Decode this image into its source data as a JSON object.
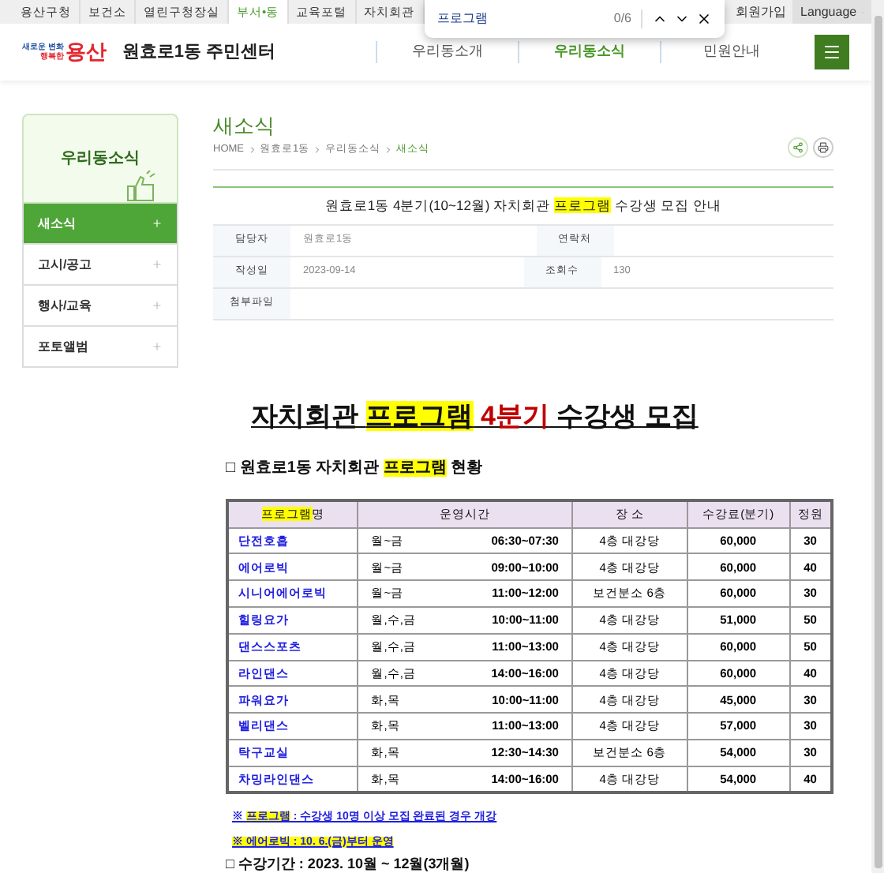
{
  "top_links": [
    {
      "label": "용산구청",
      "selected": false
    },
    {
      "label": "보건소",
      "selected": false
    },
    {
      "label": "열린구청장실",
      "selected": false
    },
    {
      "label": "부서•동",
      "selected": true
    },
    {
      "label": "교육포털",
      "selected": false
    },
    {
      "label": "자치회관",
      "selected": false
    }
  ],
  "signup": "회원가입",
  "language": "Language",
  "find_bar": {
    "query": "프로그램",
    "count": "0/6"
  },
  "logo": {
    "slogan_1": "새로운 변화",
    "slogan_2": "행복한",
    "name": "용산"
  },
  "site_title": "원효로1동 주민센터",
  "main_nav": [
    {
      "label": "우리동소개",
      "selected": false
    },
    {
      "label": "우리동소식",
      "selected": true
    },
    {
      "label": "민원안내",
      "selected": false
    }
  ],
  "sidebar": {
    "title": "우리동소식",
    "items": [
      {
        "label": "새소식",
        "selected": true
      },
      {
        "label": "고시/공고",
        "selected": false
      },
      {
        "label": "행사/교육",
        "selected": false
      },
      {
        "label": "포토앨범",
        "selected": false
      }
    ]
  },
  "page_title": "새소식",
  "breadcrumb": [
    "HOME",
    "원효로1동",
    "우리동소식",
    "새소식"
  ],
  "post": {
    "title": [
      {
        "text": "원효로1동 4분기(10~12월) 자치회관 ",
        "highlight": false
      },
      {
        "text": "프로그램",
        "highlight": true
      },
      {
        "text": " 수강생 모집 안내",
        "highlight": false
      }
    ],
    "info": [
      [
        {
          "label": "담당자",
          "value": "원효로1동"
        },
        {
          "label": "연락처"
        }
      ],
      [
        {
          "label": "작성일",
          "value": "2023-09-14"
        },
        {
          "label": "조회수",
          "value": "130"
        }
      ],
      [
        {
          "label": "첨부파일"
        }
      ]
    ]
  },
  "heading": [
    {
      "text": "자치회관 ",
      "highlight": false,
      "red": false
    },
    {
      "text": "프로그램",
      "highlight": true,
      "red": false
    },
    {
      "text": " 4분기",
      "highlight": false,
      "red": true
    },
    {
      "text": " 수강생 모집",
      "highlight": false,
      "red": false
    }
  ],
  "subheading": [
    {
      "text": "□ 원효로1동 자치회관 ",
      "highlight": false
    },
    {
      "text": "프로그램",
      "highlight": true
    },
    {
      "text": " 현황",
      "highlight": false
    }
  ],
  "table": {
    "columns": [
      [
        {
          "text": "프로그램",
          "highlight": true
        },
        {
          "text": "명",
          "highlight": false
        }
      ],
      [
        {
          "text": "운영시간",
          "highlight": false
        }
      ],
      [
        {
          "text": "장 소",
          "highlight": false
        }
      ],
      [
        {
          "text": "수강료(분기)",
          "highlight": false
        }
      ],
      [
        {
          "text": "정원",
          "highlight": false
        }
      ]
    ],
    "rows": [
      {
        "name": "단전호흡",
        "days": "월~금",
        "time": "06:30~07:30",
        "place": "4층 대강당",
        "fee": "60,000",
        "capacity": "30"
      },
      {
        "name": "에어로빅",
        "days": "월~금",
        "time": "09:00~10:00",
        "place": "4층 대강당",
        "fee": "60,000",
        "capacity": "40"
      },
      {
        "name": "시니어에어로빅",
        "days": "월~금",
        "time": "11:00~12:00",
        "place": "보건분소 6층",
        "fee": "60,000",
        "capacity": "30"
      },
      {
        "name": "힐링요가",
        "days": "월,수,금",
        "time": "10:00~11:00",
        "place": "4층 대강당",
        "fee": "51,000",
        "capacity": "50"
      },
      {
        "name": "댄스스포츠",
        "days": "월,수,금",
        "time": "11:00~13:00",
        "place": "4층 대강당",
        "fee": "60,000",
        "capacity": "50"
      },
      {
        "name": "라인댄스",
        "days": "월,수,금",
        "time": "14:00~16:00",
        "place": "4층 대강당",
        "fee": "60,000",
        "capacity": "40"
      },
      {
        "name": "파워요가",
        "days": "화,목",
        "time": "10:00~11:00",
        "place": "4층 대강당",
        "fee": "45,000",
        "capacity": "30"
      },
      {
        "name": "벨리댄스",
        "days": "화,목",
        "time": "11:00~13:00",
        "place": "4층 대강당",
        "fee": "57,000",
        "capacity": "30"
      },
      {
        "name": "탁구교실",
        "days": "화,목",
        "time": "12:30~14:30",
        "place": "보건분소 6층",
        "fee": "54,000",
        "capacity": "30"
      },
      {
        "name": "차밍라인댄스",
        "days": "화,목",
        "time": "14:00~16:00",
        "place": "4층 대강당",
        "fee": "54,000",
        "capacity": "40"
      }
    ]
  },
  "notes": [
    {
      "parts": [
        {
          "text": "※ ",
          "highlight": false
        },
        {
          "text": "프로그램",
          "highlight": true
        },
        {
          "text": " : 수강생 10명 이상 모집 완료된 경우 개강",
          "highlight": false
        }
      ]
    },
    {
      "parts": [
        {
          "text": "※ 에어로빅 : 10. 6.(금)부터 운영",
          "highlight": true
        }
      ]
    }
  ],
  "period": "□ 수강기간 : 2023. 10월 ~ 12월(3개월)"
}
